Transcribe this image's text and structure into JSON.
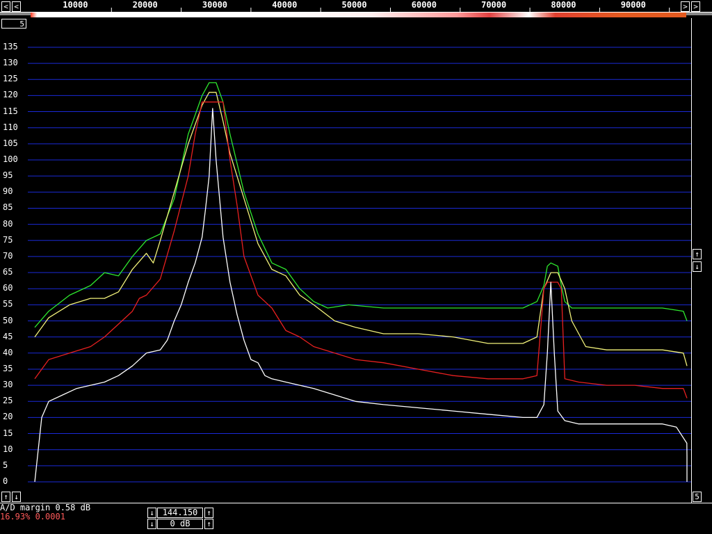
{
  "freq_axis": {
    "ticks": [
      "10000",
      "20000",
      "30000",
      "40000",
      "50000",
      "60000",
      "70000",
      "80000",
      "90000"
    ],
    "left_button": "<",
    "right_button": ">",
    "left_button2": "<",
    "right_button2": ">"
  },
  "sub_label": "5",
  "db_axis": {
    "labels": [
      "135",
      "130",
      "125",
      "120",
      "115",
      "110",
      "105",
      "100",
      "95",
      "90",
      "85",
      "80",
      "75",
      "70",
      "65",
      "60",
      "55",
      "50",
      "45",
      "40",
      "35",
      "30",
      "25",
      "20",
      "15",
      "10",
      "5",
      "0"
    ]
  },
  "buttons": {
    "bottom_left_up": "↑",
    "bottom_left_down": "↓",
    "right_up": "↑",
    "right_down": "↓",
    "right_bottom": "5"
  },
  "status": {
    "ad_margin": "A/D margin  0.58 dB",
    "cpu": "16.93% 0.0001"
  },
  "controls": {
    "freq_value": "144.150",
    "gain_value": "0 dB",
    "down": "↓",
    "up": "↑"
  },
  "colors": {
    "grid": "#1a2ad8",
    "green": "#2ee82e",
    "yellow": "#f2f27a",
    "red": "#e82020",
    "white": "#ffffff",
    "status_red": "#ff5a5a"
  },
  "chart_data": {
    "type": "line",
    "xlabel": "",
    "ylabel": "",
    "xlim": [
      0,
      96000
    ],
    "ylim": [
      0,
      138
    ],
    "series": [
      {
        "color": "green",
        "x": [
          0,
          2000,
          5000,
          8000,
          10000,
          12000,
          14000,
          16000,
          18000,
          20000,
          22000,
          24000,
          25000,
          26000,
          27000,
          28000,
          30000,
          32000,
          34000,
          36000,
          38000,
          40000,
          42000,
          45000,
          50000,
          55000,
          60000,
          65000,
          70000,
          72000,
          73000,
          73500,
          74000,
          75000,
          75500,
          76000,
          77000,
          79000,
          82000,
          86000,
          90000,
          93000,
          95000
        ],
        "y": [
          48,
          53,
          58,
          61,
          65,
          64,
          70,
          75,
          77,
          88,
          108,
          120,
          124,
          124,
          118,
          108,
          90,
          77,
          68,
          66,
          60,
          56,
          54,
          55,
          54,
          54,
          54,
          54,
          54,
          56,
          61,
          67,
          68,
          67,
          61,
          56,
          54,
          54,
          54,
          54,
          54,
          53,
          50
        ]
      },
      {
        "color": "yellow",
        "x": [
          0,
          2000,
          5000,
          8000,
          10000,
          12000,
          14000,
          16000,
          17000,
          18000,
          20000,
          22000,
          24000,
          25000,
          26000,
          27000,
          28000,
          30000,
          32000,
          34000,
          36000,
          38000,
          40000,
          43000,
          46000,
          50000,
          55000,
          60000,
          65000,
          70000,
          72000,
          73000,
          74000,
          75000,
          76000,
          77000,
          79000,
          82000,
          86000,
          90000,
          93000,
          95000
        ],
        "y": [
          45,
          51,
          55,
          57,
          57,
          59,
          66,
          71,
          68,
          75,
          90,
          105,
          117,
          121,
          121,
          112,
          102,
          88,
          74,
          66,
          64,
          58,
          55,
          50,
          48,
          46,
          46,
          45,
          43,
          43,
          45,
          60,
          65,
          65,
          60,
          50,
          42,
          41,
          41,
          41,
          40,
          36
        ]
      },
      {
        "color": "red",
        "x": [
          0,
          2000,
          5000,
          8000,
          10000,
          12000,
          14000,
          15000,
          16000,
          18000,
          20000,
          22000,
          23000,
          24000,
          25000,
          27000,
          28000,
          29000,
          30000,
          32000,
          34000,
          36000,
          38000,
          40000,
          43000,
          46000,
          50000,
          55000,
          60000,
          65000,
          70000,
          72000,
          73000,
          73500,
          75000,
          75500,
          76000,
          78000,
          82000,
          86000,
          90000,
          93000,
          95000
        ],
        "y": [
          32,
          38,
          40,
          42,
          45,
          49,
          53,
          57,
          58,
          63,
          78,
          95,
          108,
          118,
          118,
          118,
          100,
          86,
          70,
          58,
          54,
          47,
          45,
          42,
          40,
          38,
          37,
          35,
          33,
          32,
          32,
          33,
          60,
          62,
          62,
          60,
          32,
          31,
          30,
          30,
          29,
          29,
          26
        ]
      },
      {
        "color": "white",
        "x": [
          0,
          500,
          1000,
          2000,
          4000,
          6000,
          8000,
          10000,
          12000,
          14000,
          16000,
          18000,
          19000,
          20000,
          21000,
          22000,
          23000,
          24000,
          24500,
          25000,
          25500,
          26000,
          27000,
          28000,
          29000,
          30000,
          31000,
          32000,
          33000,
          34000,
          36000,
          38000,
          40000,
          43000,
          46000,
          50000,
          55000,
          60000,
          65000,
          70000,
          72000,
          73000,
          73500,
          74000,
          74500,
          75000,
          76000,
          78000,
          82000,
          86000,
          90000,
          92000,
          93500,
          94500,
          95000
        ],
        "y": [
          0,
          10,
          20,
          25,
          27,
          29,
          30,
          31,
          33,
          36,
          40,
          41,
          44,
          50,
          55,
          62,
          68,
          76,
          85,
          95,
          116,
          100,
          76,
          62,
          52,
          44,
          38,
          37,
          33,
          32,
          31,
          30,
          29,
          27,
          25,
          24,
          23,
          22,
          21,
          20,
          20,
          24,
          40,
          62,
          40,
          22,
          19,
          18,
          18,
          18,
          18,
          17,
          12,
          8,
          0
        ]
      }
    ]
  }
}
